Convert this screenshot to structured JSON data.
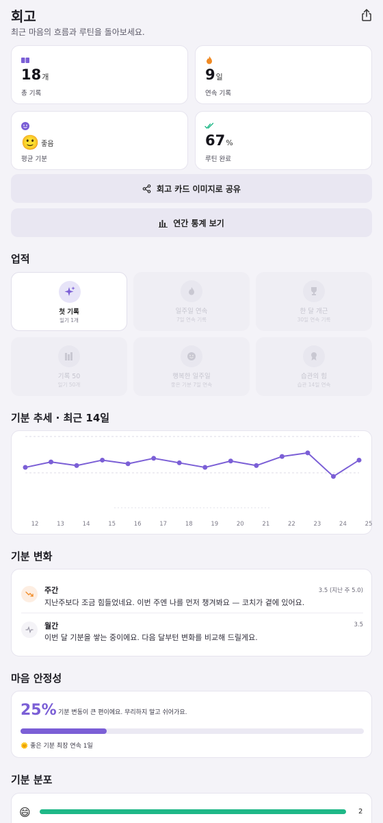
{
  "header": {
    "title": "회고",
    "subtitle": "최근 마음의 흐름과 루틴을 돌아보세요."
  },
  "stats": {
    "records": {
      "value": "18",
      "unit": "개",
      "label": "총 기록",
      "icon": "book-icon"
    },
    "streak": {
      "value": "9",
      "unit": "일",
      "label": "연속 기록",
      "icon": "flame-icon"
    },
    "mood": {
      "emoji": "🙂",
      "value": "좋음",
      "label": "평균 기분",
      "icon": "smile-icon"
    },
    "routine": {
      "value": "67",
      "unit": "%",
      "label": "루틴 완료",
      "icon": "double-check-icon"
    }
  },
  "actions": {
    "share_card": "회고 카드 이미지로 공유",
    "yearly_stats": "연간 통계 보기"
  },
  "achievements": {
    "title": "업적",
    "items": [
      {
        "title": "첫 기록",
        "sub": "일기 1개",
        "icon": "sparkles-icon",
        "unlocked": true
      },
      {
        "title": "일주일 연속",
        "sub": "7일 연속 기록",
        "icon": "flame-icon",
        "unlocked": false
      },
      {
        "title": "한 달 개근",
        "sub": "30일 연속 기록",
        "icon": "trophy-icon",
        "unlocked": false
      },
      {
        "title": "기록 50",
        "sub": "일기 50개",
        "icon": "books-icon",
        "unlocked": false
      },
      {
        "title": "행복한 일주일",
        "sub": "좋은 기분 7일 연속",
        "icon": "smile-icon",
        "unlocked": false
      },
      {
        "title": "습관의 힘",
        "sub": "습관 14일 연속",
        "icon": "medal-icon",
        "unlocked": false
      }
    ]
  },
  "trend": {
    "title": "기분 추세 · 최근 14일"
  },
  "chart_data": {
    "type": "line",
    "x": [
      "12",
      "13",
      "14",
      "15",
      "16",
      "17",
      "18",
      "19",
      "20",
      "21",
      "22",
      "23",
      "24",
      "25"
    ],
    "series": [
      {
        "values": [
          4.3,
          4.6,
          4.4,
          4.7,
          4.5,
          4.8,
          4.55,
          4.3,
          4.65,
          4.4,
          4.9,
          5.1,
          3.8,
          4.7
        ]
      }
    ],
    "color": "#7b5fd6",
    "ylim": [
      2,
      6
    ],
    "grid": true
  },
  "mood_change": {
    "title": "기분 변화",
    "rows": [
      {
        "label": "주간",
        "text": "지난주보다 조금 힘들었네요. 이번 주엔 나를 먼저 챙겨봐요 — 코치가 곁에 있어요.",
        "score": "3.5 (지난 주 5.0)",
        "icon": "trend-down-icon"
      },
      {
        "label": "월간",
        "text": "이번 달 기분을 쌓는 중이에요. 다음 달부턴 변화를 비교해 드릴게요.",
        "score": "3.5",
        "icon": "pulse-icon"
      }
    ]
  },
  "stability": {
    "title": "마음 안정성",
    "percent": "25%",
    "fill": 0.25,
    "message": "기분 변동이 큰 편이에요. 무리하지 말고 쉬어가요.",
    "footer": "🌞 좋은 기분 최장 연속 1일"
  },
  "distribution": {
    "title": "기분 분포",
    "rows": [
      {
        "emoji": "😄",
        "count": "2",
        "fill": 1.0
      }
    ]
  },
  "colors": {
    "accent": "#7b5fd6",
    "green": "#1fb887",
    "orange": "#f08a24"
  }
}
